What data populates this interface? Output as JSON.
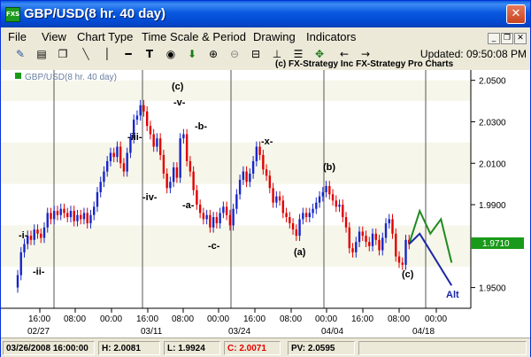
{
  "window": {
    "app_icon": "FXS",
    "title": "GBP/USD(8 hr.  40 day)",
    "close_icon": "close-icon"
  },
  "menu": [
    "File",
    "View",
    "Chart Type",
    "Time Scale & Period",
    "Drawing",
    "Indicators"
  ],
  "toolbar": {
    "icons": [
      "pencil-icon",
      "print-icon",
      "copy-icon",
      "line-icon",
      "h-line-icon",
      "text-icon",
      "v-line-icon",
      "dot-icon",
      "down-arrow-icon",
      "zoom-in-icon",
      "zoom-out-icon",
      "lock-icon",
      "label-icon",
      "sort-icon",
      "measure-icon",
      "left-arrow-icon",
      "right-arrow-icon"
    ],
    "updated_label": "Updated: 09:50:08 PM"
  },
  "copyright": "(c) FX-Strategy Inc  FX-Strategy Pro Charts",
  "legend": "GBP/USD(8 hr.  40 day)",
  "chart_data": {
    "type": "candlestick",
    "symbol": "GBP/USD",
    "ylim": [
      1.94,
      2.055
    ],
    "y_ticks": [
      "2.0500",
      "2.0300",
      "2.0100",
      "1.9900",
      "1.9710",
      "1.9500"
    ],
    "last_price": "1.9710",
    "x_ticks_time": [
      "16:00",
      "08:00",
      "00:00",
      "16:00",
      "08:00",
      "00:00",
      "16:00",
      "08:00",
      "00:00",
      "16:00",
      "08:00",
      "00:00"
    ],
    "x_ticks_date": [
      "02/27",
      "03/11",
      "03/24",
      "04/04",
      "04/18"
    ],
    "closes": [
      1.956,
      1.967,
      1.971,
      1.975,
      1.973,
      1.978,
      1.976,
      1.974,
      1.979,
      1.986,
      1.983,
      1.987,
      1.985,
      1.988,
      1.986,
      1.984,
      1.987,
      1.982,
      1.985,
      1.983,
      1.986,
      1.981,
      1.985,
      1.989,
      1.996,
      2.001,
      2.006,
      2.011,
      2.015,
      2.013,
      2.018,
      2.01,
      2.006,
      2.015,
      2.022,
      2.031,
      2.033,
      2.038,
      2.035,
      2.028,
      2.024,
      2.018,
      2.022,
      2.014,
      2.005,
      1.998,
      2.001,
      2.008,
      2.003,
      2.022,
      2.024,
      2.011,
      2.006,
      1.997,
      1.99,
      1.986,
      1.983,
      1.985,
      1.979,
      1.984,
      1.981,
      1.986,
      1.989,
      1.985,
      1.98,
      1.988,
      1.995,
      2.002,
      2.006,
      2.001,
      2.005,
      2.011,
      2.018,
      2.014,
      2.007,
      2.004,
      1.998,
      1.991,
      1.994,
      1.992,
      1.986,
      1.984,
      1.981,
      1.978,
      1.975,
      1.983,
      1.986,
      1.984,
      1.986,
      1.988,
      1.991,
      1.994,
      1.996,
      1.999,
      1.995,
      1.992,
      1.989,
      1.99,
      1.984,
      1.979,
      1.969,
      1.967,
      1.972,
      1.977,
      1.975,
      1.972,
      1.97,
      1.976,
      1.973,
      1.968,
      1.974,
      1.981,
      1.983,
      1.976,
      1.965,
      1.962,
      1.961,
      1.973,
      1.971
    ],
    "forecast": [
      {
        "name": "",
        "color": "#1f8a1f",
        "points": [
          [
            1.971,
            0
          ],
          [
            1.987,
            1
          ],
          [
            1.976,
            2
          ],
          [
            1.983,
            3
          ],
          [
            1.962,
            4
          ]
        ]
      },
      {
        "name": "Alt",
        "color": "#1826a8",
        "points": [
          [
            1.971,
            0
          ],
          [
            1.976,
            1
          ],
          [
            1.951,
            4
          ]
        ]
      }
    ],
    "wave_labels": [
      "-i-",
      "-ii-",
      "-iii-",
      "-iv-",
      "(c)",
      "-v-",
      "-a-",
      "-b-",
      "-c-",
      "-x-",
      "(a)",
      "(b)",
      "(c)",
      "Alt"
    ]
  },
  "status": {
    "datetime": "03/26/2008 16:00:00",
    "high": "H: 2.0081",
    "low": "L: 1.9924",
    "close": "C: 2.0071",
    "pv": "PV: 2.0595"
  },
  "colors": {
    "up": "#1826c8",
    "down": "#e00000",
    "close_text": "#e00000",
    "price_marker": "#1a9a1a"
  }
}
